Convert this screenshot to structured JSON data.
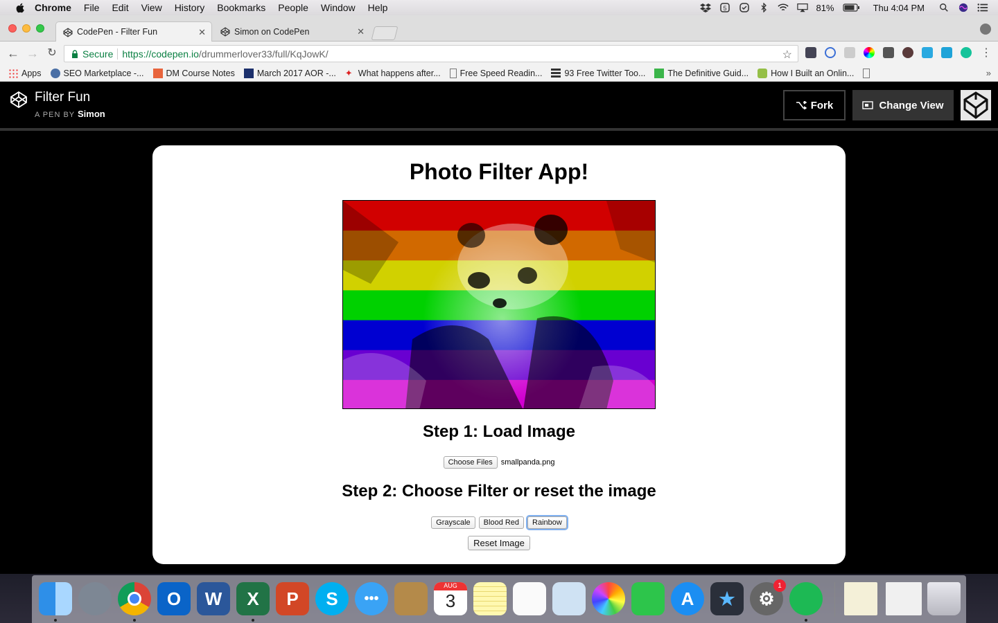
{
  "menubar": {
    "app": "Chrome",
    "items": [
      "File",
      "Edit",
      "View",
      "History",
      "Bookmarks",
      "People",
      "Window",
      "Help"
    ],
    "battery": "81%",
    "clock": "Thu 4:04 PM"
  },
  "tabs": [
    {
      "title": "CodePen - Filter Fun",
      "active": true
    },
    {
      "title": "Simon on CodePen",
      "active": false
    }
  ],
  "address": {
    "secure_label": "Secure",
    "url_scheme_host": "https://codepen.io",
    "url_path": "/drummerlover33/full/KqJowK/"
  },
  "bookmarks": [
    {
      "label": "Apps",
      "icon": "apps-grid-icon"
    },
    {
      "label": "SEO Marketplace -...",
      "icon": "seo-icon"
    },
    {
      "label": "DM Course Notes",
      "icon": "m-icon"
    },
    {
      "label": "March 2017 AOR -...",
      "icon": "flag-icon"
    },
    {
      "label": "What happens after...",
      "icon": "maple-leaf-icon"
    },
    {
      "label": "Free Speed Readin...",
      "icon": "page-icon"
    },
    {
      "label": "93 Free Twitter Too...",
      "icon": "buffer-icon"
    },
    {
      "label": "The Definitive Guid...",
      "icon": "q-icon"
    },
    {
      "label": "How I Built an Onlin...",
      "icon": "shopify-icon"
    }
  ],
  "codepen": {
    "title": "Filter Fun",
    "by_prefix": "A PEN BY",
    "author": "Simon",
    "fork_label": "Fork",
    "change_view_label": "Change View"
  },
  "app": {
    "heading": "Photo Filter App!",
    "step1": "Step 1: Load Image",
    "choose_files_label": "Choose Files",
    "file_name": "smallpanda.png",
    "step2": "Step 2: Choose Filter or reset the image",
    "filters": [
      "Grayscale",
      "Blood Red",
      "Rainbow"
    ],
    "active_filter": "Rainbow",
    "reset_label": "Reset Image",
    "rainbow_colors": [
      "#ff0000",
      "#ff8000",
      "#ffff00",
      "#00ff00",
      "#0000ff",
      "#8000ff",
      "#ff00ff"
    ]
  },
  "dock": {
    "calendar_month": "AUG",
    "calendar_day": "3",
    "badge_count": "1"
  }
}
